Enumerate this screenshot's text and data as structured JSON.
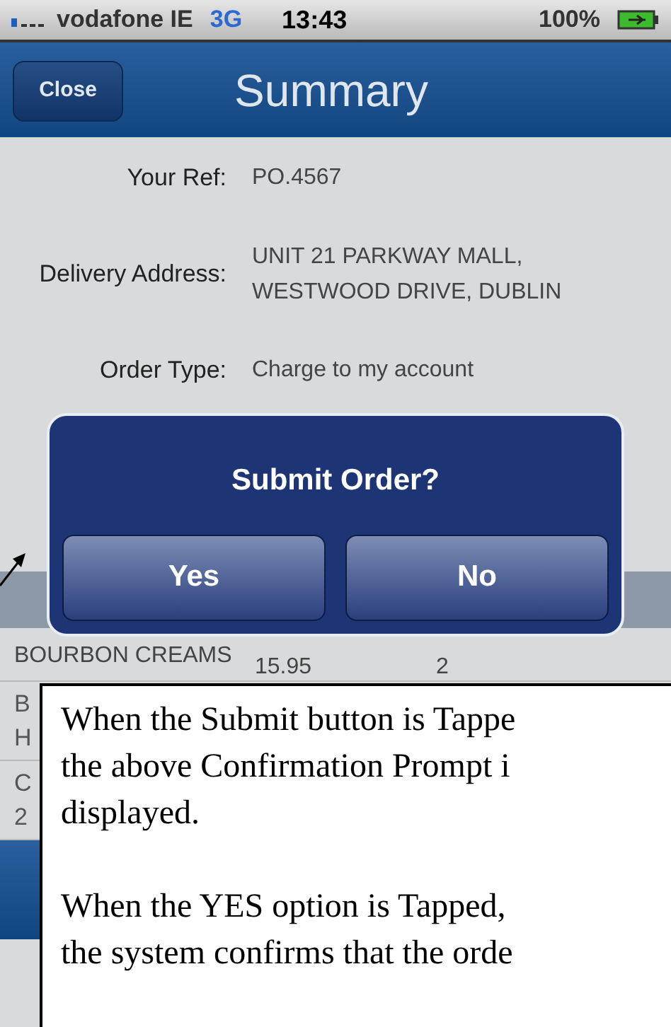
{
  "status_bar": {
    "carrier": "vodafone IE",
    "network": "3G",
    "time": "13:43",
    "battery": "100%"
  },
  "nav_bar": {
    "close_button": "Close",
    "title": "Summary"
  },
  "fields": [
    {
      "label": "Your Ref:",
      "value": [
        "PO.4567"
      ]
    },
    {
      "label": "Delivery Address:",
      "value": [
        "UNIT 21 PARKWAY MALL,",
        "WESTWOOD DRIVE, DUBLIN"
      ]
    },
    {
      "label": "Order Type:",
      "value": [
        "Charge to my account"
      ]
    }
  ],
  "items": {
    "first_row": {
      "name": "BOURBON CREAMS",
      "price": "15.95",
      "qty": "2"
    },
    "clipped_rows": [
      [
        "B",
        "H"
      ],
      [
        "C",
        "2"
      ]
    ]
  },
  "alert": {
    "title": "Submit Order?",
    "buttons": [
      "Yes",
      "No"
    ]
  },
  "annotation": {
    "paragraphs": [
      [
        "When the Submit button is Tappe",
        "the above Confirmation Prompt i",
        "displayed."
      ],
      [
        "When the YES option is Tapped,",
        "the system confirms that the orde"
      ]
    ]
  }
}
